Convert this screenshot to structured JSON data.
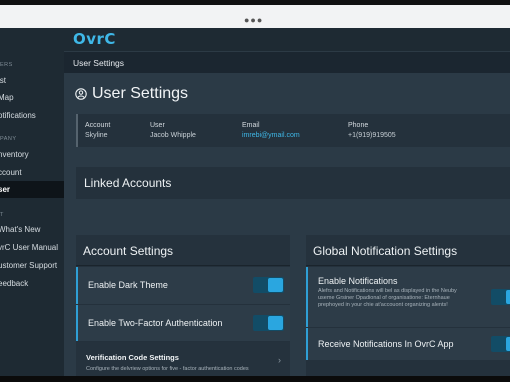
{
  "sidebar": {
    "sections": [
      "ERS",
      "PANY",
      "T"
    ],
    "items": [
      {
        "label": "ist",
        "active": false
      },
      {
        "label": "Map",
        "active": false
      },
      {
        "label": "otifications",
        "active": false
      },
      {
        "label": "nventory",
        "active": false
      },
      {
        "label": "ccount",
        "active": false
      },
      {
        "label": "ser",
        "active": true
      },
      {
        "label": "What's New",
        "active": false
      },
      {
        "label": "vrC User Manual",
        "active": false
      },
      {
        "label": "ustomer Support",
        "active": false
      },
      {
        "label": "eedback",
        "active": false
      }
    ]
  },
  "topbar": {
    "logo": "OvrC"
  },
  "subheader": {
    "title": "User Settings"
  },
  "page": {
    "title": "User Settings",
    "title_icon": "user-circle-icon"
  },
  "info": {
    "account_label": "Account",
    "account_value": "Skyline",
    "user_label": "User",
    "user_value": "Jacob Whipple",
    "email_label": "Email",
    "email_value": "imrebi@ymail.com",
    "phone_label": "Phone",
    "phone_value": "+1(919)919505"
  },
  "linked": {
    "title": "Linked Accounts"
  },
  "account_settings": {
    "title": "Account Settings",
    "dark_theme_label": "Enable Dark Theme",
    "dark_theme_on": true,
    "two_factor_label": "Enable Two-Factor Authentication",
    "two_factor_on": true,
    "verification_title": "Verification Code Settings",
    "verification_desc": "Configure the delvriew options for five - factor authentication codes"
  },
  "global_notifications": {
    "title": "Global Notification Settings",
    "enable_label": "Enable Notifications",
    "enable_desc": "Alefrs and Notifications will bel as displayed in the Neuby useme Grsiner Opadional of organisatione: Eternhaue prephoyed in your chie at'accouont organizing alents!",
    "enable_on": true,
    "receive_label": "Receive Notifications In OvrC App",
    "receive_on": true
  },
  "colors": {
    "accent": "#2aa6e0",
    "sidebar_bg": "#1e2a33",
    "main_bg": "#2b3a46",
    "card_bg": "#24313c"
  }
}
